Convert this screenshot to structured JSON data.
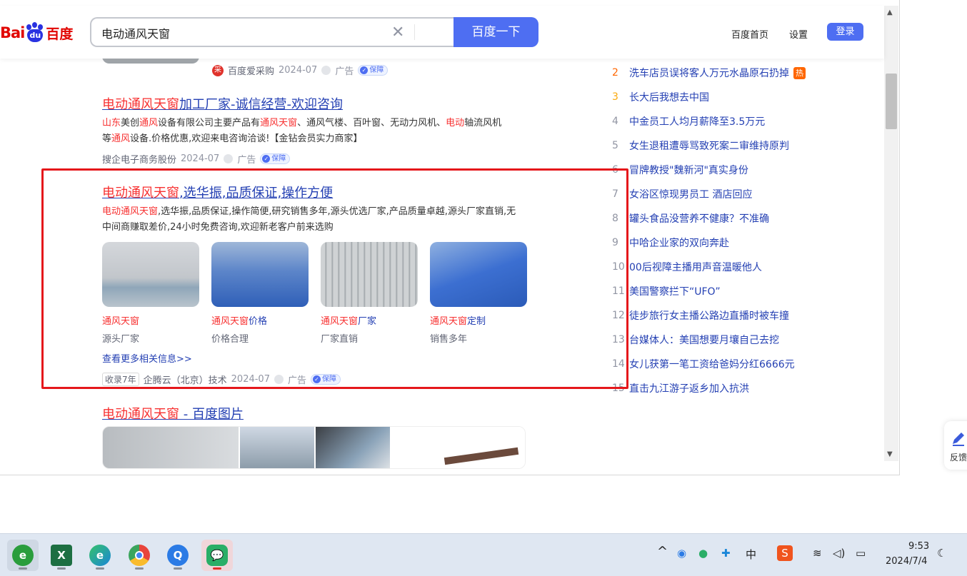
{
  "header": {
    "logo_bai": "Bai",
    "logo_du": "du",
    "logo_cn": "百度",
    "search_value": "电动通风天窗",
    "search_button": "百度一下",
    "nav_home": "百度首页",
    "nav_settings": "设置",
    "login": "登录"
  },
  "results": {
    "r0": {
      "caigou_icon_text": "采",
      "source": "百度爱采购",
      "date": "2024-07",
      "ad": "广告",
      "badge": "保障"
    },
    "r1": {
      "title_red": "电动通风天窗",
      "title_rest": "加工厂家-诚信经营-欢迎咨询",
      "snippet_parts": [
        "山东",
        "美创",
        "通风",
        "设备有限公司主要产品有",
        "通风天窗",
        "、通风气楼、百叶窗、无动力风机、",
        "电动",
        "轴流风机",
        "等",
        "通风",
        "设备.价格优惠,欢迎来电咨询洽谈!【金钻会员实力商家】"
      ],
      "source": "搜企电子商务股份",
      "date": "2024-07",
      "ad": "广告",
      "badge": "保障"
    },
    "r2": {
      "title_red": "电动通风天窗",
      "title_rest": ",选华振,品质保证,操作方便",
      "snippet_red": "电动通风天窗",
      "snippet_rest": ",选华振,品质保证,操作简便,研究销售多年,源头优选厂家,产品质量卓越,源头厂家直销,无中间商赚取差价,24小时免费咨询,欢迎新老客户前来选购",
      "cards": [
        {
          "title_red": "通风天窗",
          "title_rest": "",
          "sub": "源头厂家"
        },
        {
          "title_red": "通风天窗",
          "title_rest": "价格",
          "sub": "价格合理"
        },
        {
          "title_red": "通风天窗",
          "title_rest": "厂家",
          "sub": "厂家直销"
        },
        {
          "title_red": "通风天窗",
          "title_rest": "定制",
          "sub": "销售多年"
        }
      ],
      "more_link": "查看更多相关信息>>",
      "shoulu": "收录7年",
      "source": "企腾云（北京）技术",
      "date": "2024-07",
      "ad": "广告",
      "badge": "保障"
    },
    "r3": {
      "title_red": "电动通风天窗",
      "title_rest": " - 百度图片"
    }
  },
  "hotlist": [
    {
      "num": "2",
      "text": "洗车店员误将客人万元水晶原石扔掉",
      "tag": "热",
      "color": "#ff6600"
    },
    {
      "num": "3",
      "text": "长大后我想去中国",
      "tag": "",
      "color": "#faa90e"
    },
    {
      "num": "4",
      "text": "中金员工人均月薪降至3.5万元",
      "tag": "",
      "color": "#9195a3"
    },
    {
      "num": "5",
      "text": "女生退租遭辱骂致死案二审维持原判",
      "tag": "",
      "color": "#9195a3"
    },
    {
      "num": "6",
      "text": "冒牌教授\"魏新河\"真实身份",
      "tag": "",
      "color": "#9195a3"
    },
    {
      "num": "7",
      "text": "女浴区惊现男员工 酒店回应",
      "tag": "",
      "color": "#9195a3"
    },
    {
      "num": "8",
      "text": "罐头食品没营养不健康？不准确",
      "tag": "",
      "color": "#9195a3"
    },
    {
      "num": "9",
      "text": "中哈企业家的双向奔赴",
      "tag": "",
      "color": "#9195a3"
    },
    {
      "num": "10",
      "text": "00后视障主播用声音温暖他人",
      "tag": "",
      "color": "#9195a3"
    },
    {
      "num": "11",
      "text": "美国警察拦下“UFO”",
      "tag": "",
      "color": "#9195a3"
    },
    {
      "num": "12",
      "text": "徒步旅行女主播公路边直播时被车撞",
      "tag": "",
      "color": "#9195a3"
    },
    {
      "num": "13",
      "text": "台媒体人：美国想要月壤自己去挖",
      "tag": "",
      "color": "#9195a3"
    },
    {
      "num": "14",
      "text": "女儿获第一笔工资给爸妈分红6666元",
      "tag": "",
      "color": "#9195a3"
    },
    {
      "num": "15",
      "text": "直击九江游子返乡加入抗洪",
      "tag": "",
      "color": "#9195a3"
    }
  ],
  "feedback": {
    "label": "反馈"
  },
  "taskbar": {
    "apps": [
      {
        "name": "ie",
        "glyph": "e",
        "color": "#2a9d3c"
      },
      {
        "name": "excel",
        "glyph": "X",
        "color": "#1d6f42"
      },
      {
        "name": "edge",
        "glyph": "e",
        "color": "#1a86d8"
      },
      {
        "name": "chrome",
        "glyph": "",
        "color": "#e8453c"
      },
      {
        "name": "qq-browser",
        "glyph": "Q",
        "color": "#2b7be5"
      },
      {
        "name": "wechat",
        "glyph": "",
        "color": "#2aae67"
      }
    ],
    "tray_chevron": "^",
    "ime": "中",
    "sogou": "S",
    "time": "9:53",
    "date": "2024/7/4"
  },
  "colors": {
    "accent": "#4e6ef2",
    "highlight_box": "#e5171b",
    "link": "#2440b3",
    "em_red": "#f73131"
  }
}
